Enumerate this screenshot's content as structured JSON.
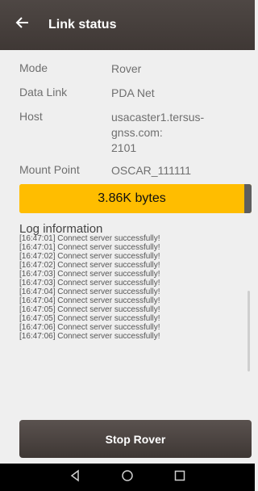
{
  "header": {
    "title": "Link status"
  },
  "info": {
    "mode_label": "Mode",
    "mode_value": "Rover",
    "datalink_label": "Data Link",
    "datalink_value": "PDA Net",
    "host_label": "Host",
    "host_line1": "usacaster1.tersus-",
    "host_line2": "gnss.com:",
    "host_line3": "2101",
    "mount_label": "Mount Point",
    "mount_value": "OSCAR_111111"
  },
  "progress": {
    "text": "3.86K bytes",
    "fill_fraction": 1.0
  },
  "log": {
    "title": "Log information",
    "lines": [
      "[16:47:01] Connect server successfully!",
      "[16:47:01] Connect server successfully!",
      "[16:47:02] Connect server successfully!",
      "[16:47:02] Connect server successfully!",
      "[16:47:03] Connect server successfully!",
      "[16:47:03] Connect server successfully!",
      "[16:47:04] Connect server successfully!",
      "[16:47:04] Connect server successfully!",
      "[16:47:05] Connect server successfully!",
      "[16:47:05] Connect server successfully!",
      "[16:47:06] Connect server successfully!",
      "[16:47:06] Connect server successfully!"
    ]
  },
  "actions": {
    "stop_label": "Stop Rover"
  },
  "icons": {
    "back": "arrow-left-icon",
    "nav_back": "triangle-back-icon",
    "nav_home": "circle-home-icon",
    "nav_recent": "square-recent-icon"
  },
  "colors": {
    "accent": "#ffbd00",
    "appbar": "#4a4340",
    "button": "#4c4542"
  }
}
